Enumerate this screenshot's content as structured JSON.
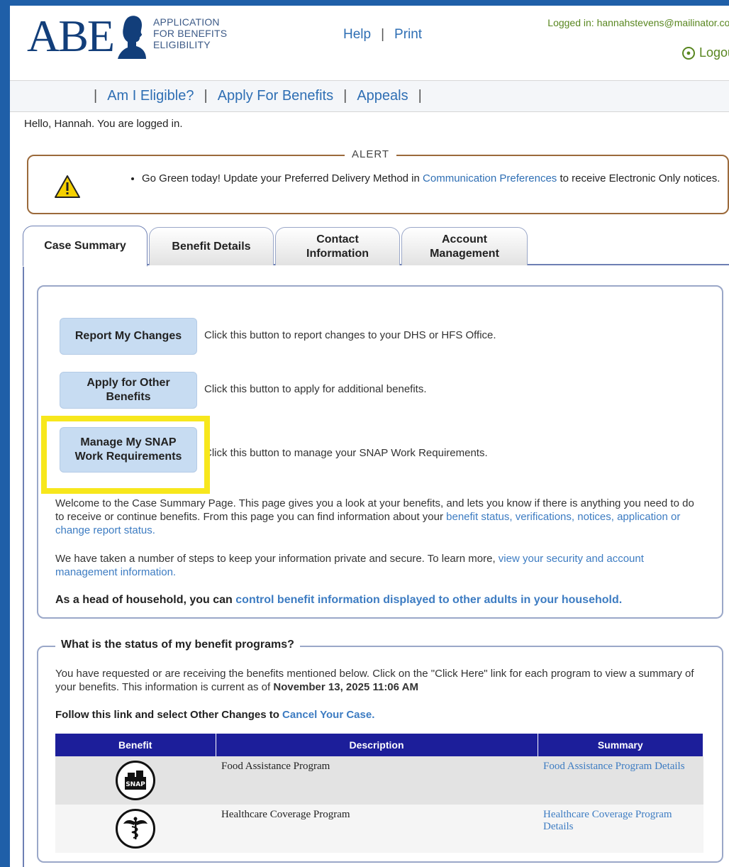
{
  "header": {
    "logo_text": "ABE",
    "logo_subtitle": [
      "APPLICATION",
      "FOR BENEFITS",
      "ELIGIBILITY"
    ],
    "help_label": "Help",
    "print_label": "Print",
    "logged_in_text": "Logged in: hannahstevens@mailinator.cor",
    "logout_label": "Logou"
  },
  "nav": {
    "items": [
      "Am I Eligible?",
      "Apply For Benefits",
      "Appeals"
    ],
    "separator": "|"
  },
  "greeting": "Hello, Hannah. You are logged in.",
  "alert": {
    "title": "ALERT",
    "text_before": "Go Green today! Update your Preferred Delivery Method in ",
    "link": "Communication Preferences",
    "text_after": " to receive Electronic Only notices."
  },
  "tabs": [
    "Case Summary",
    "Benefit Details",
    "Contact Information",
    "Account Management"
  ],
  "actions": [
    {
      "label": "Report My Changes",
      "desc": "Click this button to report changes to your DHS or HFS Office."
    },
    {
      "label": "Apply for Other Benefits",
      "desc": "Click this button to apply for additional benefits."
    },
    {
      "label": "Manage My SNAP Work Requirements",
      "desc": "Click this button to manage your SNAP Work Requirements."
    }
  ],
  "welcome": {
    "text": "Welcome to the Case Summary Page. This page gives you a look at your benefits, and lets you know if there is anything you need to do to receive or continue benefits. From this page you can find information about your ",
    "link": "benefit status, verifications, notices, application or change report status."
  },
  "security": {
    "text": "We have taken a number of steps to keep your information private and secure. To learn more, ",
    "link": "view your security and account management information."
  },
  "household": {
    "text": "As a head of household, you can ",
    "link": "control benefit information displayed to other adults in your household."
  },
  "status": {
    "legend": "What is the status of my benefit programs?",
    "intro": "You have requested or are receiving the benefits mentioned below. Click on the \"Click Here\" link for each program to view a summary of your benefits. This information is current as of ",
    "date": "November 13, 2025 11:06 AM",
    "follow_text": "Follow this link and select Other Changes to ",
    "follow_link": "Cancel Your Case.",
    "columns": [
      "Benefit",
      "Description",
      "Summary"
    ],
    "rows": [
      {
        "icon": "snap-icon",
        "description": "Food Assistance Program",
        "summary": "Food Assistance Program Details"
      },
      {
        "icon": "caduceus-icon",
        "description": "Healthcare Coverage Program",
        "summary": "Healthcare Coverage Program Details"
      }
    ]
  },
  "colors": {
    "brand": "#123e7a",
    "link": "#2f6fb4",
    "table_header": "#1c1e9a",
    "highlight": "#f7e71c",
    "button": "#c7dcf2"
  }
}
